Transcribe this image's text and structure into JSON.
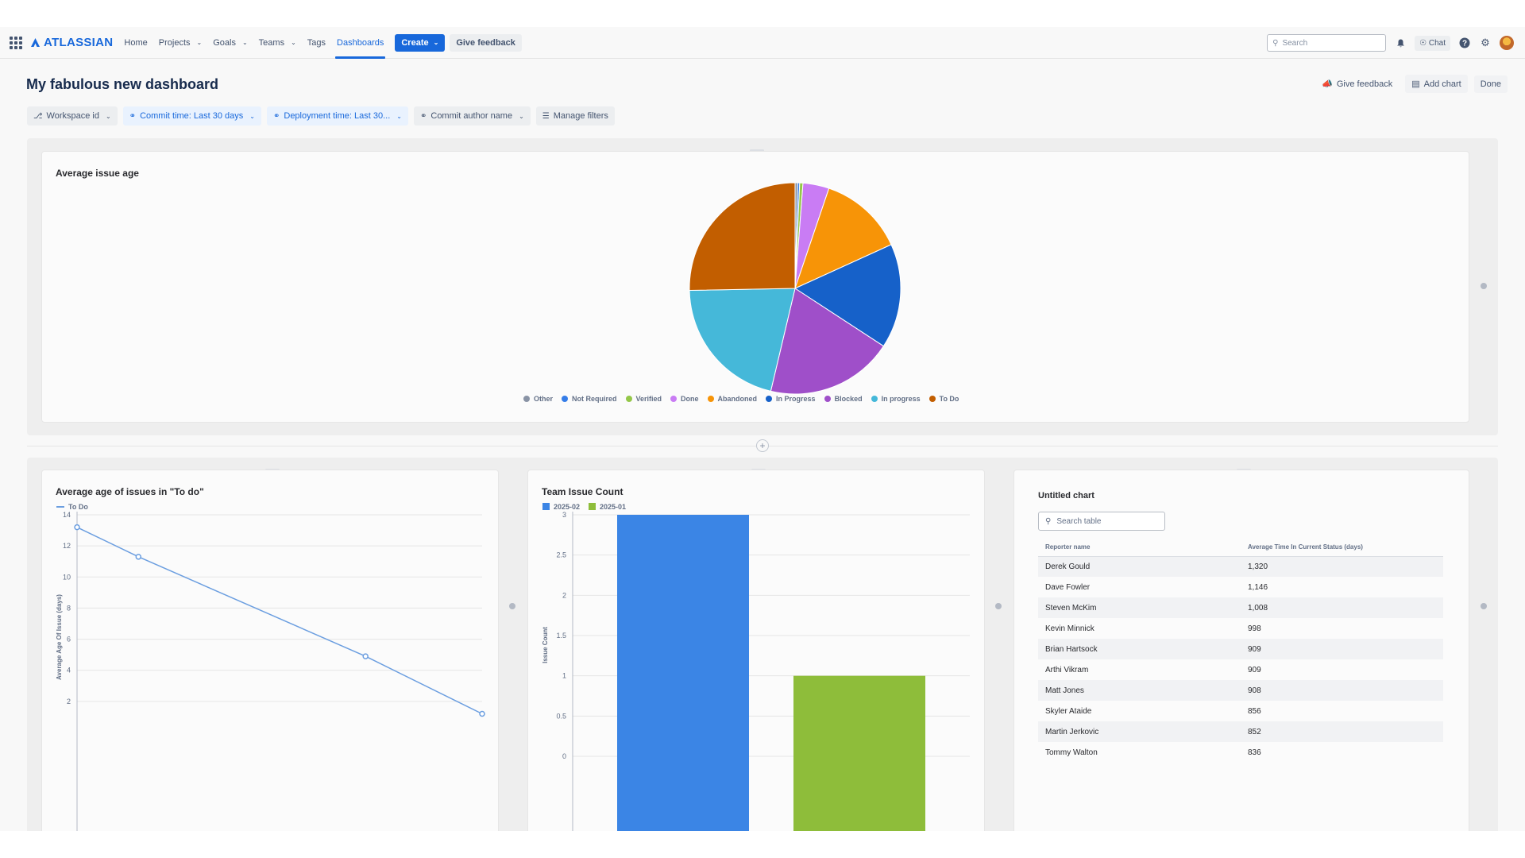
{
  "nav": {
    "logo": "ATLASSIAN",
    "items": [
      {
        "label": "Home",
        "chevron": false
      },
      {
        "label": "Projects",
        "chevron": true
      },
      {
        "label": "Goals",
        "chevron": true
      },
      {
        "label": "Teams",
        "chevron": true
      },
      {
        "label": "Tags",
        "chevron": false
      },
      {
        "label": "Dashboards",
        "chevron": false,
        "active": true
      }
    ],
    "create_label": "Create",
    "feedback_label": "Give feedback",
    "search_placeholder": "Search",
    "chat_label": "Chat"
  },
  "header": {
    "title": "My fabulous new dashboard",
    "give_feedback": "Give feedback",
    "add_chart": "Add chart",
    "done": "Done"
  },
  "filters": [
    {
      "label": "Workspace id",
      "style": "grey"
    },
    {
      "label": "Commit time: Last 30 days",
      "style": "blue"
    },
    {
      "label": "Deployment time: Last 30...",
      "style": "blue"
    },
    {
      "label": "Commit author name",
      "style": "grey"
    },
    {
      "label": "Manage filters",
      "style": "grey"
    }
  ],
  "pie": {
    "title": "Average issue age",
    "chart_data": {
      "type": "pie",
      "slices": [
        {
          "label": "Other",
          "value": 0.4,
          "color": "#8993a5"
        },
        {
          "label": "Not Required",
          "value": 0.3,
          "color": "#357de8"
        },
        {
          "label": "Verified",
          "value": 0.5,
          "color": "#94c748"
        },
        {
          "label": "Done",
          "value": 4.0,
          "color": "#c97cf4"
        },
        {
          "label": "Abandoned",
          "value": 13.0,
          "color": "#f79407"
        },
        {
          "label": "In Progress",
          "value": 16.0,
          "color": "#1661c9"
        },
        {
          "label": "Blocked",
          "value": 19.5,
          "color": "#9f4fc9"
        },
        {
          "label": "In progress",
          "value": 21.0,
          "color": "#45b8d9"
        },
        {
          "label": "To Do",
          "value": 25.3,
          "color": "#c25e00"
        }
      ]
    }
  },
  "line": {
    "title": "Average age of issues in \"To do\"",
    "chart_data": {
      "type": "line",
      "series": [
        {
          "name": "To Do",
          "color": "#6b9ee0",
          "points": [
            [
              0,
              13.2
            ],
            [
              1,
              11.3
            ],
            [
              4.7,
              4.9
            ],
            [
              6.6,
              1.2
            ]
          ]
        }
      ],
      "ylabel": "Average Age Of Issue (days)",
      "yticks": [
        2,
        4,
        6,
        8,
        10,
        12,
        14
      ],
      "ylim": [
        0,
        14
      ],
      "xlim": [
        0,
        6.6
      ]
    }
  },
  "bar": {
    "title": "Team Issue Count",
    "chart_data": {
      "type": "bar",
      "series": [
        {
          "name": "2025-02",
          "value": 3,
          "color": "#3b85e5"
        },
        {
          "name": "2025-01",
          "value": 1,
          "color": "#8ebd3a"
        }
      ],
      "ylabel": "Issue Count",
      "yticks": [
        "0",
        "0.5",
        "1",
        "1.5",
        "2",
        "2.5",
        "3"
      ],
      "ylim": [
        0,
        3
      ]
    }
  },
  "table": {
    "title": "Untitled chart",
    "search_placeholder": "Search table",
    "columns": [
      "Reporter name",
      "Average Time In Current Status (days)"
    ],
    "rows": [
      [
        "Derek Gould",
        "1,320"
      ],
      [
        "Dave Fowler",
        "1,146"
      ],
      [
        "Steven McKim",
        "1,008"
      ],
      [
        "Kevin Minnick",
        "998"
      ],
      [
        "Brian Hartsock",
        "909"
      ],
      [
        "Arthi Vikram",
        "909"
      ],
      [
        "Matt Jones",
        "908"
      ],
      [
        "Skyler Ataide",
        "856"
      ],
      [
        "Martin Jerkovic",
        "852"
      ],
      [
        "Tommy Walton",
        "836"
      ]
    ]
  }
}
